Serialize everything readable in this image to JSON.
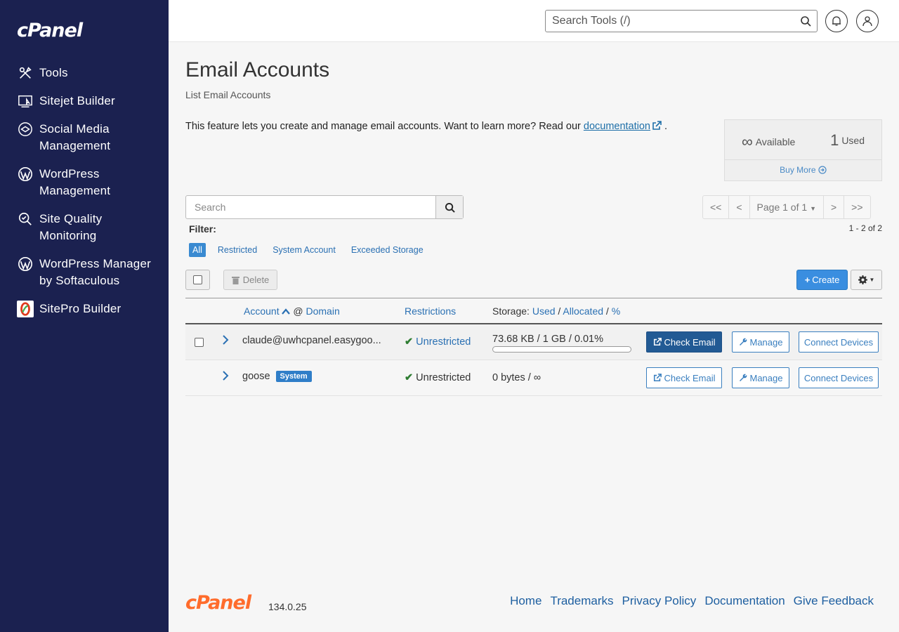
{
  "brand": {
    "logo_text": "cPanel",
    "version": "134.0.25",
    "footer_logo_color": "#ff6c2c",
    "sidebar_bg": "#1b2150"
  },
  "sidebar": {
    "items": [
      {
        "label": "Tools",
        "icon": "tools-icon"
      },
      {
        "label": "Sitejet Builder",
        "icon": "sitejet-icon"
      },
      {
        "label": "Social Media Management",
        "icon": "social-media-icon"
      },
      {
        "label": "WordPress Management",
        "icon": "wordpress-icon"
      },
      {
        "label": "Site Quality Monitoring",
        "icon": "site-quality-icon"
      },
      {
        "label": "WordPress Manager by Softaculous",
        "icon": "wordpress-icon"
      },
      {
        "label": "SitePro Builder",
        "icon": "sitepro-icon"
      }
    ]
  },
  "topbar": {
    "search_placeholder": "Search Tools (/)"
  },
  "page": {
    "title": "Email Accounts",
    "subtitle": "List Email Accounts",
    "intro_text": "This feature lets you create and manage email accounts. Want to learn more? Read our ",
    "intro_link": "documentation",
    "intro_end": "."
  },
  "stats": {
    "available_symbol": "∞",
    "available_label": "Available",
    "used_count": "1",
    "used_label": "Used",
    "buy_more": "Buy More"
  },
  "list": {
    "search_placeholder": "Search",
    "pager": {
      "first": "<<",
      "prev": "<",
      "page": "Page 1 of 1",
      "next": ">",
      "last": ">>"
    },
    "count": "1 - 2 of 2",
    "filter_label": "Filter:",
    "filters": [
      "All",
      "Restricted",
      "System Account",
      "Exceeded Storage"
    ],
    "delete_label": "Delete",
    "create_label": "Create"
  },
  "table": {
    "headers": {
      "account": "Account",
      "at": "@",
      "domain": "Domain",
      "restrictions": "Restrictions",
      "storage_prefix": "Storage:",
      "used": "Used",
      "allocated": "Allocated",
      "percent": "%",
      "sep": "/"
    },
    "rows": [
      {
        "account": "claude@uwhcpanel.easygoo...",
        "badge": "",
        "restriction": "Unrestricted",
        "storage": "73.68 KB / 1 GB / 0.01%",
        "usage_percent": 0.01,
        "check_email": "Check Email",
        "manage": "Manage",
        "connect": "Connect Devices"
      },
      {
        "account": "goose",
        "badge": "System",
        "restriction": "Unrestricted",
        "storage": "0 bytes / ∞",
        "check_email": "Check Email",
        "manage": "Manage",
        "connect": "Connect Devices"
      }
    ]
  },
  "footer": {
    "links": [
      "Home",
      "Trademarks",
      "Privacy Policy",
      "Documentation",
      "Give Feedback"
    ]
  }
}
